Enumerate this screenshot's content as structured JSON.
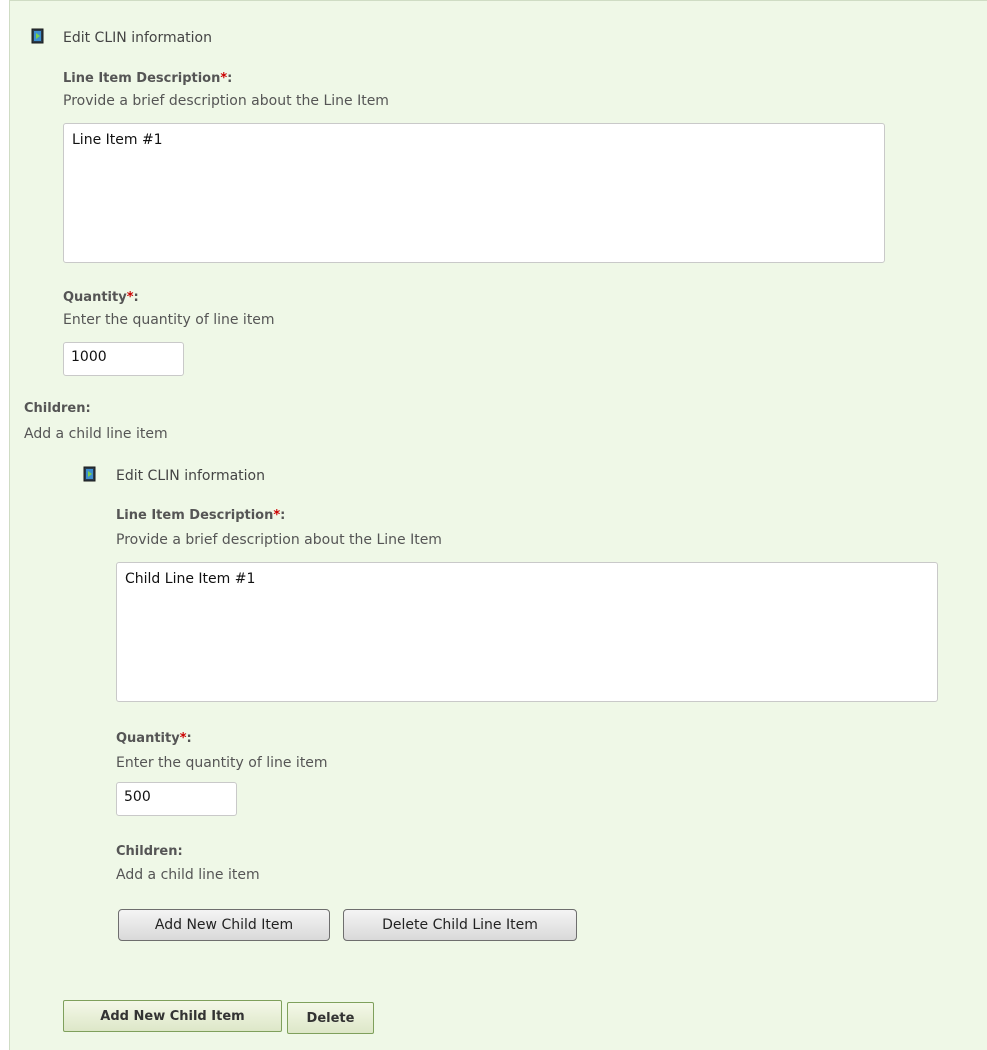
{
  "outer": {
    "header": "Edit CLIN information",
    "description_label": "Line Item Description",
    "required_mark": "*",
    "description_hint": "Provide a brief description about the Line Item",
    "description_value": "Line Item #1",
    "quantity_label": "Quantity",
    "quantity_hint": "Enter the quantity of line item",
    "quantity_value": "1000",
    "children_label": "Children:",
    "children_hint": "Add a child line item",
    "add_child_button": "Add New Child Item",
    "delete_button": "Delete"
  },
  "child": {
    "header": "Edit CLIN information",
    "description_label": "Line Item Description",
    "required_mark": "*",
    "description_hint": "Provide a brief description about the Line Item",
    "description_value": "Child Line Item #1",
    "quantity_label": "Quantity",
    "quantity_hint": "Enter the quantity of line item",
    "quantity_value": "500",
    "children_label": "Children:",
    "children_hint": "Add a child line item",
    "add_child_button": "Add New Child Item",
    "delete_button": "Delete Child Line Item"
  },
  "colors": {
    "panel_bg": "#eff8e7",
    "required": "#cc0000"
  },
  "icons": {
    "edit": "edit-document-icon"
  }
}
